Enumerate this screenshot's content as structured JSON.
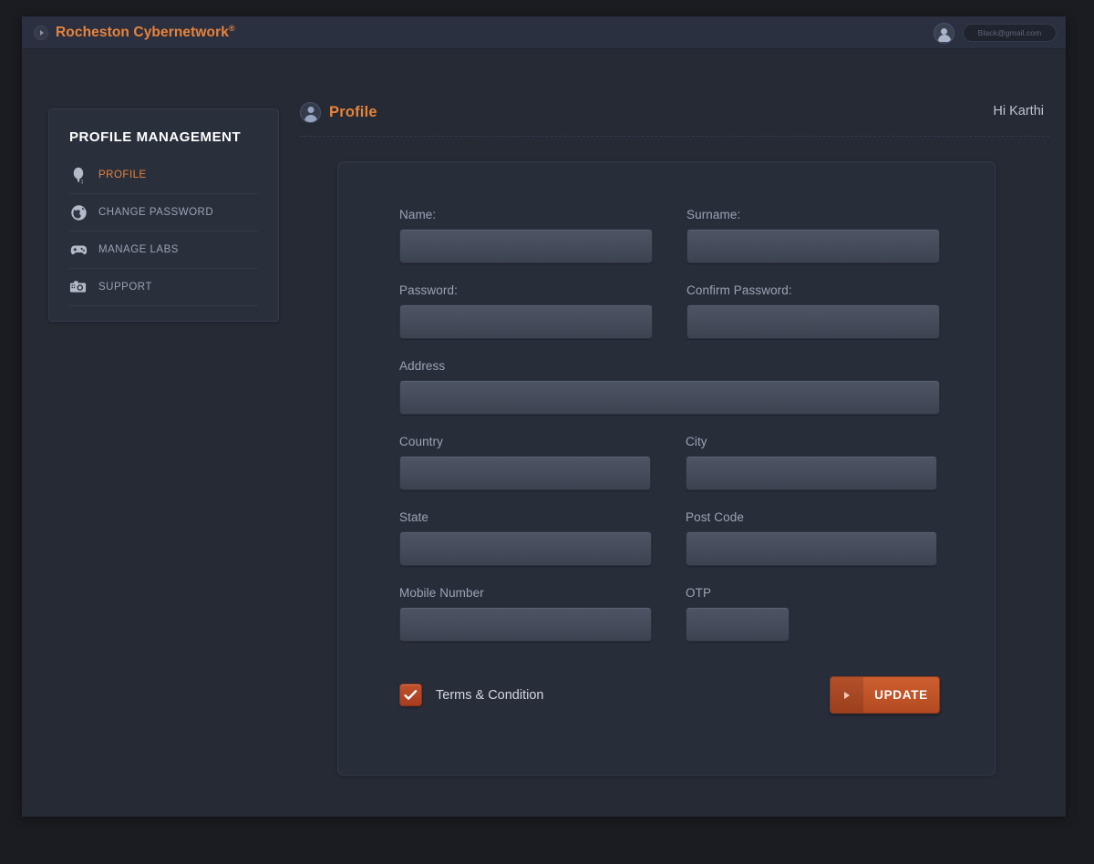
{
  "topbar": {
    "logo_icon": "play-circle-icon",
    "brand": "Rocheston Cybernetwork",
    "brand_mark": "®",
    "avatar_icon": "user-avatar-icon",
    "email_value": "Black@gmail.com",
    "email_placeholder": "Black@gmail.com"
  },
  "sidebar": {
    "title": "PROFILE MANAGEMENT",
    "items": [
      {
        "label": "PROFILE",
        "icon": "balloon-icon",
        "active": true
      },
      {
        "label": "CHANGE PASSWORD",
        "icon": "globe-icon",
        "active": false
      },
      {
        "label": "MANAGE LABS",
        "icon": "gamepad-icon",
        "active": false
      },
      {
        "label": "SUPPORT",
        "icon": "camera-icon",
        "active": false
      }
    ]
  },
  "page": {
    "icon": "user-avatar-icon",
    "title": "Profile",
    "greeting": "Hi Karthi"
  },
  "form": {
    "fields": {
      "name": {
        "label": "Name:",
        "value": "",
        "placeholder": ""
      },
      "surname": {
        "label": "Surname:",
        "value": "",
        "placeholder": ""
      },
      "password": {
        "label": "Password:",
        "value": "",
        "placeholder": ""
      },
      "confirm_password": {
        "label": "Confirm Password:",
        "value": "",
        "placeholder": ""
      },
      "address": {
        "label": "Address",
        "value": "",
        "placeholder": ""
      },
      "country": {
        "label": "Country",
        "value": "",
        "placeholder": ""
      },
      "city": {
        "label": "City",
        "value": "",
        "placeholder": ""
      },
      "state": {
        "label": "State",
        "value": "",
        "placeholder": ""
      },
      "post_code": {
        "label": "Post Code",
        "value": "",
        "placeholder": ""
      },
      "mobile_number": {
        "label": "Mobile Number",
        "value": "",
        "placeholder": ""
      },
      "otp": {
        "label": "OTP",
        "value": "",
        "placeholder": ""
      }
    },
    "terms": {
      "label": "Terms & Condition",
      "checked": true
    },
    "submit": {
      "label": "UPDATE",
      "icon": "play-arrow-icon"
    }
  },
  "colors": {
    "accent": "#e8833a",
    "button": "#cc5f30",
    "checkbox": "#b2502a",
    "panel": "#2a2f3c",
    "card": "#282d3a",
    "app_bg": "#252a35",
    "page_bg": "#1b1c21",
    "topbar": "#2b3040",
    "label_text": "#9ba3b4",
    "input_bg": "#4a5160"
  }
}
